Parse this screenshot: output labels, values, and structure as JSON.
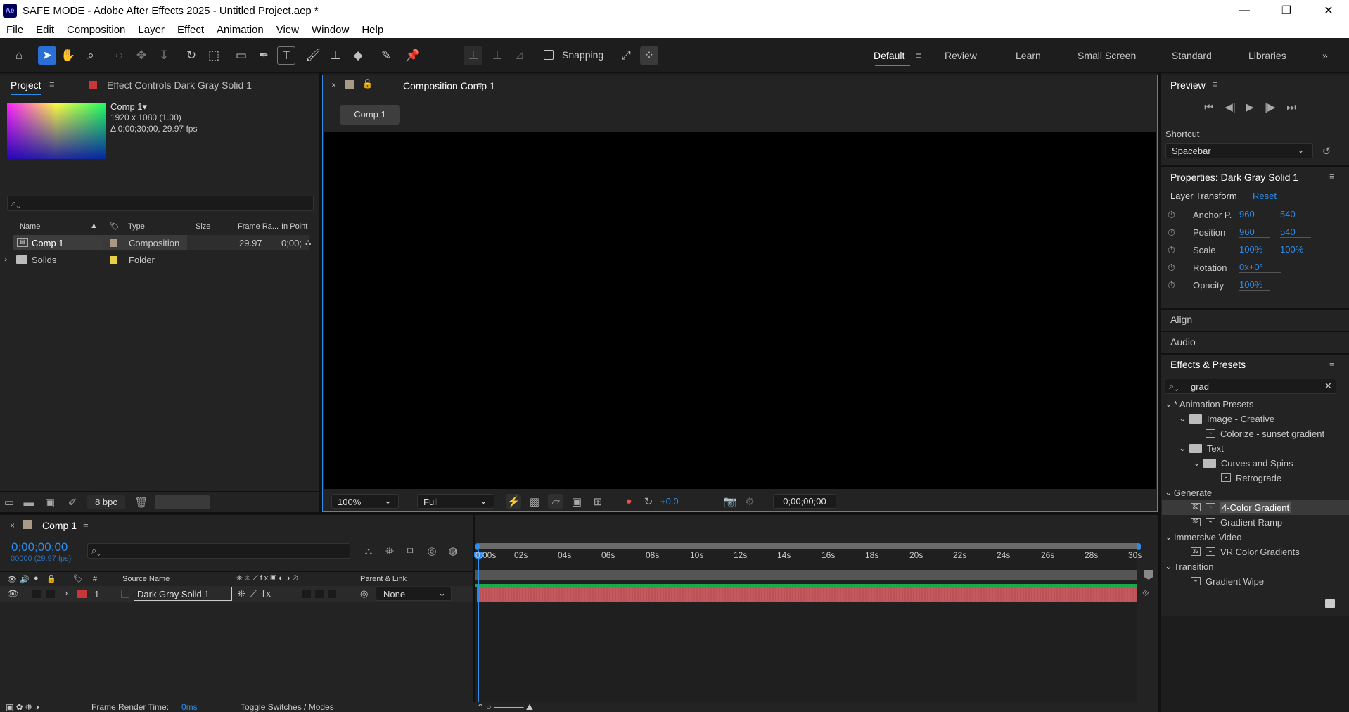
{
  "window": {
    "title": "SAFE MODE - Adobe After Effects 2025 - Untitled Project.aep *",
    "app_badge": "Ae",
    "controls": {
      "minimize": "—",
      "restore": "❐",
      "close": "✕"
    }
  },
  "menu": [
    "File",
    "Edit",
    "Composition",
    "Layer",
    "Effect",
    "Animation",
    "View",
    "Window",
    "Help"
  ],
  "toolbar": {
    "snapping_label": "Snapping",
    "workspaces": [
      "Default",
      "Review",
      "Learn",
      "Small Screen",
      "Standard",
      "Libraries"
    ],
    "active_workspace": "Default",
    "more": "»"
  },
  "project_panel": {
    "tab_project": "Project",
    "tab_effect_controls": "Effect Controls Dark Gray Solid 1",
    "preview": {
      "name": "Comp 1▾",
      "dims": "1920 x 1080 (1.00)",
      "duration": "Δ 0;00;30;00, 29.97 fps"
    },
    "search_placeholder": "",
    "columns": [
      "Name",
      "Type",
      "Size",
      "Frame Ra...",
      "In Point"
    ],
    "items": [
      {
        "name": "Comp 1",
        "type": "Composition",
        "size": "",
        "frame_rate": "29.97",
        "in_point": "0;00;",
        "label_color": "#a89a84"
      },
      {
        "name": "Solids",
        "type": "Folder",
        "size": "",
        "frame_rate": "",
        "in_point": "",
        "label_color": "#e6d046"
      }
    ],
    "bpc": "8 bpc"
  },
  "composition": {
    "tab_title": "Composition Comp 1",
    "breadcrumb": "Comp 1",
    "zoom": "100%",
    "resolution": "Full",
    "exposure": "+0.0",
    "timecode": "0;00;00;00"
  },
  "preview_panel": {
    "title": "Preview",
    "shortcut_label": "Shortcut",
    "shortcut_value": "Spacebar"
  },
  "properties": {
    "title": "Properties: Dark Gray Solid 1",
    "section": "Layer Transform",
    "reset": "Reset",
    "rows": [
      {
        "name": "Anchor P.",
        "v1": "960",
        "v2": "540"
      },
      {
        "name": "Position",
        "v1": "960",
        "v2": "540"
      },
      {
        "name": "Scale",
        "v1": "100%",
        "v2": "100%"
      },
      {
        "name": "Rotation",
        "v1": "0x+0°",
        "v2": ""
      },
      {
        "name": "Opacity",
        "v1": "100%",
        "v2": ""
      }
    ]
  },
  "align_label": "Align",
  "audio_label": "Audio",
  "effects_presets": {
    "title": "Effects & Presets",
    "search": "grad",
    "tree": {
      "animation_presets": "* Animation Presets",
      "image_creative": "Image - Creative",
      "colorize": "Colorize - sunset gradient",
      "text": "Text",
      "curves_spins": "Curves and Spins",
      "retrograde": "Retrograde",
      "generate": "Generate",
      "four_color": "4-Color Gradient",
      "gradient_ramp": "Gradient Ramp",
      "immersive": "Immersive Video",
      "vr_color": "VR Color Gradients",
      "transition": "Transition",
      "gradient_wipe": "Gradient Wipe"
    }
  },
  "timeline": {
    "tab": "Comp 1",
    "timecode": "0;00;00;00",
    "frames": "00000 (29.97 fps)",
    "col_num": "#",
    "col_source": "Source Name",
    "col_parent": "Parent & Link",
    "layer": {
      "index": "1",
      "name": "Dark Gray Solid 1",
      "parent": "None",
      "label_color": "#c8363a"
    },
    "ticks": [
      "0:00s",
      "02s",
      "04s",
      "06s",
      "08s",
      "10s",
      "12s",
      "14s",
      "16s",
      "18s",
      "20s",
      "22s",
      "24s",
      "26s",
      "28s",
      "30s"
    ],
    "render_time_label": "Frame Render Time:",
    "render_time_value": "0ms",
    "toggle_label": "Toggle Switches / Modes"
  },
  "colors": {
    "accent": "#2d8ceb",
    "layer_bar": "#c4545a",
    "workarea": "#2d8ceb"
  }
}
